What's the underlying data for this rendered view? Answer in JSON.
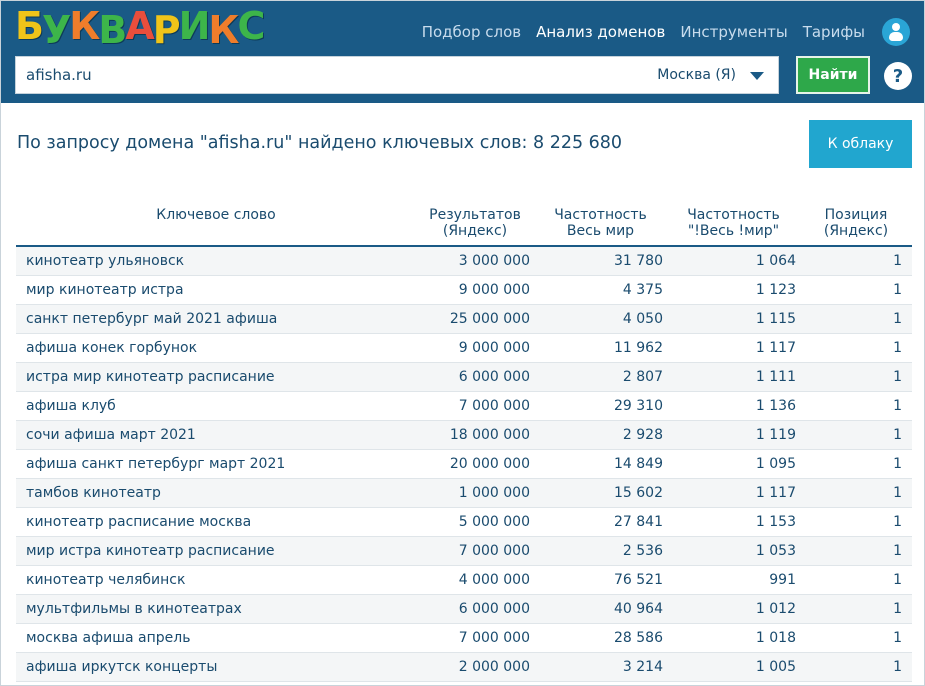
{
  "brand": {
    "logo_letters": [
      {
        "ch": "Б",
        "color": "#f0c419"
      },
      {
        "ch": "У",
        "color": "#3db54a"
      },
      {
        "ch": "К",
        "color": "#ef7d2b"
      },
      {
        "ch": "В",
        "color": "#3db54a"
      },
      {
        "ch": "А",
        "color": "#e94e3c"
      },
      {
        "ch": "Р",
        "color": "#f0c419"
      },
      {
        "ch": "И",
        "color": "#3db54a"
      },
      {
        "ch": "К",
        "color": "#ef7d2b"
      },
      {
        "ch": "С",
        "color": "#3db54a"
      }
    ]
  },
  "nav": {
    "items": [
      "Подбор слов",
      "Анализ доменов",
      "Инструменты",
      "Тарифы"
    ],
    "active_index": 1
  },
  "search": {
    "value": "afisha.ru",
    "region": "Москва (Я)",
    "submit_label": "Найти",
    "help_label": "?"
  },
  "summary": {
    "text": "По запросу домена \"afisha.ru\" найдено ключевых слов: 8 225 680",
    "cloud_button": "К облаку"
  },
  "table": {
    "headers": [
      {
        "line1": "Ключевое слово",
        "line2": ""
      },
      {
        "line1": "Результатов",
        "line2": "(Яндекс)"
      },
      {
        "line1": "Частотность",
        "line2": "Весь мир"
      },
      {
        "line1": "Частотность",
        "line2": "\"!Весь !мир\""
      },
      {
        "line1": "Позиция",
        "line2": "(Яндекс)"
      }
    ],
    "rows": [
      [
        "кинотеатр ульяновск",
        "3 000 000",
        "31 780",
        "1 064",
        "1"
      ],
      [
        "мир кинотеатр истра",
        "9 000 000",
        "4 375",
        "1 123",
        "1"
      ],
      [
        "санкт петербург май 2021 афиша",
        "25 000 000",
        "4 050",
        "1 115",
        "1"
      ],
      [
        "афиша конек горбунок",
        "9 000 000",
        "11 962",
        "1 117",
        "1"
      ],
      [
        "истра мир кинотеатр расписание",
        "6 000 000",
        "2 807",
        "1 111",
        "1"
      ],
      [
        "афиша клуб",
        "7 000 000",
        "29 310",
        "1 136",
        "1"
      ],
      [
        "сочи афиша март 2021",
        "18 000 000",
        "2 928",
        "1 119",
        "1"
      ],
      [
        "афиша санкт петербург март 2021",
        "20 000 000",
        "14 849",
        "1 095",
        "1"
      ],
      [
        "тамбов кинотеатр",
        "1 000 000",
        "15 602",
        "1 117",
        "1"
      ],
      [
        "кинотеатр расписание москва",
        "5 000 000",
        "27 841",
        "1 153",
        "1"
      ],
      [
        "мир истра кинотеатр расписание",
        "7 000 000",
        "2 536",
        "1 053",
        "1"
      ],
      [
        "кинотеатр челябинск",
        "4 000 000",
        "76 521",
        "991",
        "1"
      ],
      [
        "мультфильмы в кинотеатрах",
        "6 000 000",
        "40 964",
        "1 012",
        "1"
      ],
      [
        "москва афиша апрель",
        "7 000 000",
        "28 586",
        "1 018",
        "1"
      ],
      [
        "афиша иркутск концерты",
        "2 000 000",
        "3 214",
        "1 005",
        "1"
      ]
    ]
  }
}
